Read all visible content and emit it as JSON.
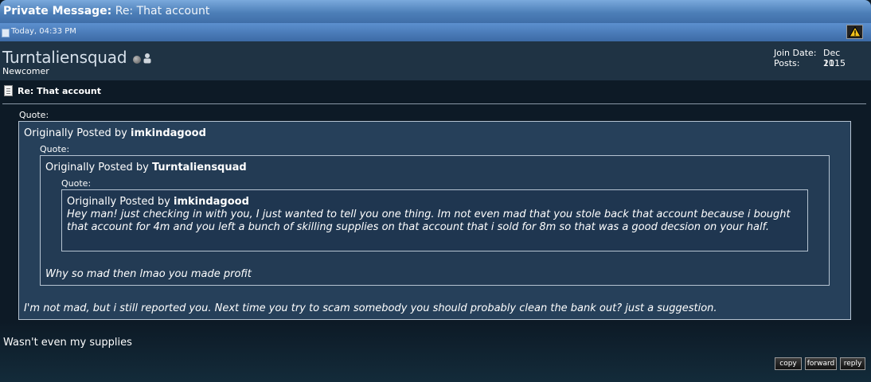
{
  "header": {
    "label": "Private Message:",
    "subject": "Re: That account"
  },
  "meta": {
    "date": "Today, 04:33 PM"
  },
  "user": {
    "name": "Turntaliensquad",
    "title": "Newcomer",
    "join_label": "Join Date:",
    "join_value": "Dec 2015",
    "posts_label": "Posts:",
    "posts_value": "11"
  },
  "post": {
    "title": "Re: That account",
    "quote_label": "Quote:",
    "q1": {
      "prefix": "Originally Posted by",
      "author": "imkindagood",
      "text": "I'm not mad, but i still reported you. Next time you try to scam somebody you should probably clean the bank out? just a suggestion."
    },
    "q2": {
      "prefix": "Originally Posted by",
      "author": "Turntaliensquad",
      "text": "Why so mad then lmao you made profit"
    },
    "q3": {
      "prefix": "Originally Posted by",
      "author": "imkindagood",
      "text": "Hey man! just checking in with you, I just wanted to tell you one thing. Im not even mad that you stole back that account because i bought that account for 4m and you left a bunch of skilling supplies on that account that i sold for 8m so that was a good decsion on your half."
    },
    "reply": "Wasn't even my supplies"
  },
  "buttons": {
    "copy": "copy",
    "forward": "forward",
    "reply": "reply"
  }
}
